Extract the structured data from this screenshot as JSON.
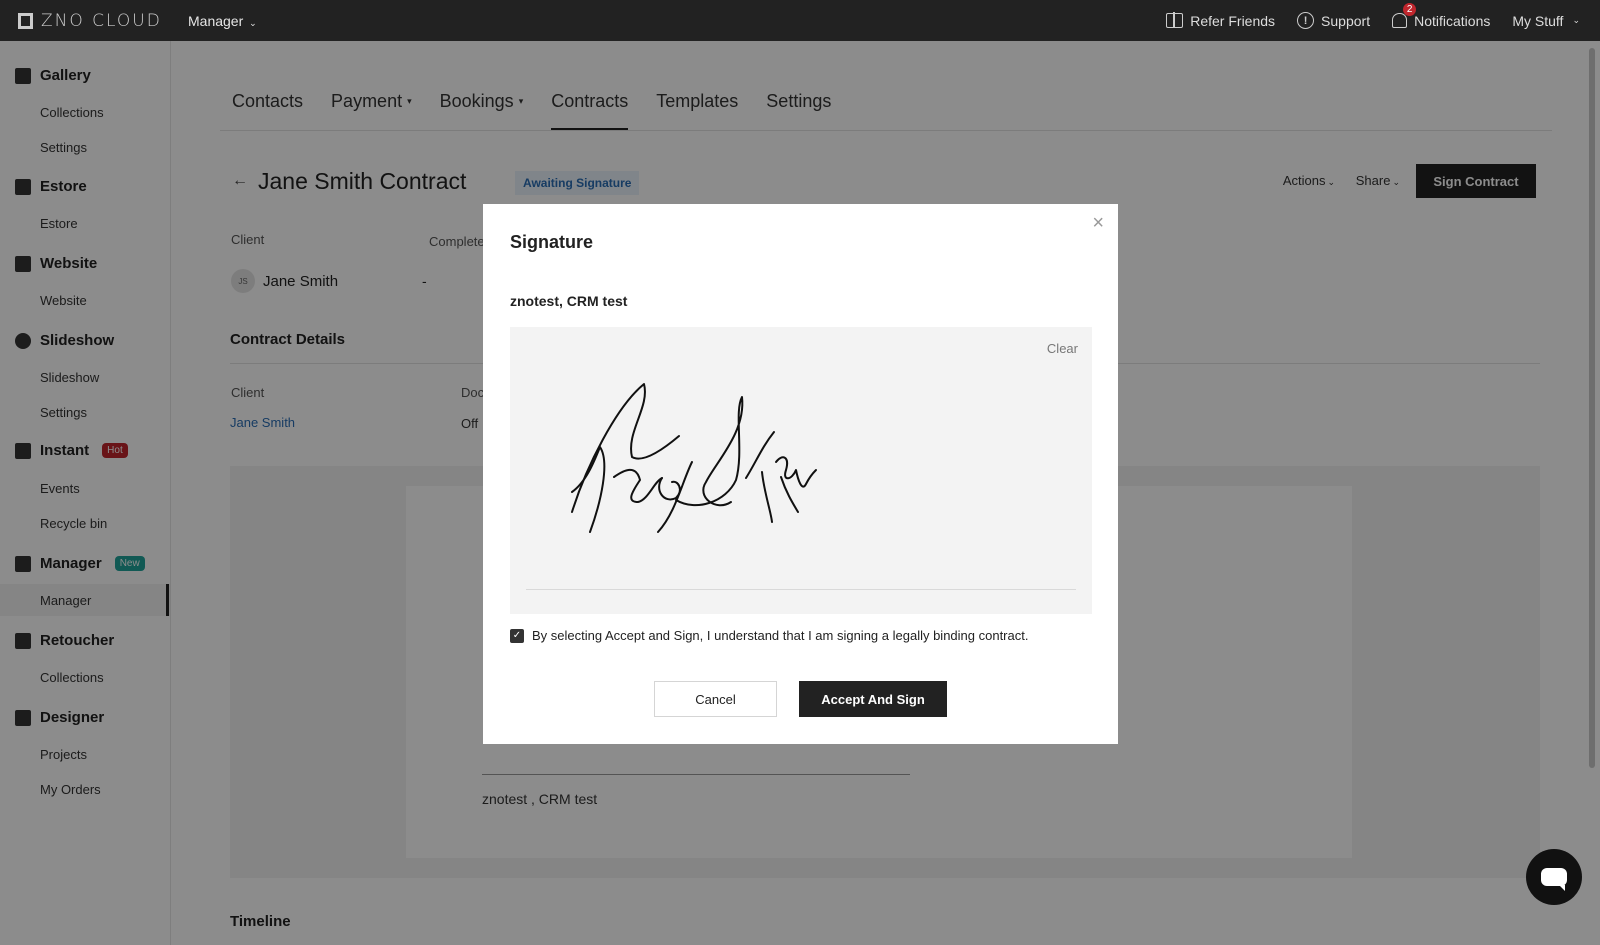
{
  "topbar": {
    "logo": "ZNO CLOUD",
    "manager": "Manager",
    "refer": "Refer Friends",
    "support": "Support",
    "notifications": "Notifications",
    "notif_count": "2",
    "mystuff": "My Stuff"
  },
  "sidebar": {
    "gallery": "Gallery",
    "gallery_collections": "Collections",
    "gallery_settings": "Settings",
    "estore": "Estore",
    "estore_sub": "Estore",
    "website": "Website",
    "website_sub": "Website",
    "slideshow": "Slideshow",
    "slideshow_sub": "Slideshow",
    "slideshow_settings": "Settings",
    "instant": "Instant",
    "instant_tag": "Hot",
    "events": "Events",
    "recycle": "Recycle bin",
    "manager": "Manager",
    "manager_tag": "New",
    "manager_sub": "Manager",
    "retoucher": "Retoucher",
    "retoucher_collections": "Collections",
    "designer": "Designer",
    "projects": "Projects",
    "orders": "My Orders"
  },
  "tabs": [
    "Contacts",
    "Payment",
    "Bookings",
    "Contracts",
    "Templates",
    "Settings"
  ],
  "contract": {
    "title": "Jane Smith Contract",
    "status": "Awaiting Signature",
    "actions": "Actions",
    "share": "Share",
    "sign_button": "Sign Contract",
    "client_label": "Client",
    "completed_label": "Complete",
    "client_initials": "JS",
    "client_name": "Jane Smith",
    "completed_value": "-",
    "details_title": "Contract Details",
    "details_client_label": "Client",
    "details_doc_label": "Doc",
    "details_client_value": "Jane Smith",
    "details_doc_value": "Off",
    "doc_signer": "znotest , CRM test",
    "timeline": "Timeline"
  },
  "modal": {
    "title": "Signature",
    "signer": "znotest, CRM test",
    "clear": "Clear",
    "consent": "By selecting Accept and Sign, I understand that I am signing a legally binding contract.",
    "consent_checked": true,
    "cancel": "Cancel",
    "accept": "Accept And Sign"
  },
  "colors": {
    "topbar": "#222222",
    "primary_button": "#222222",
    "badge_text": "#2a6db5",
    "hot_tag": "#c0262d",
    "new_tag": "#1fa39a"
  }
}
